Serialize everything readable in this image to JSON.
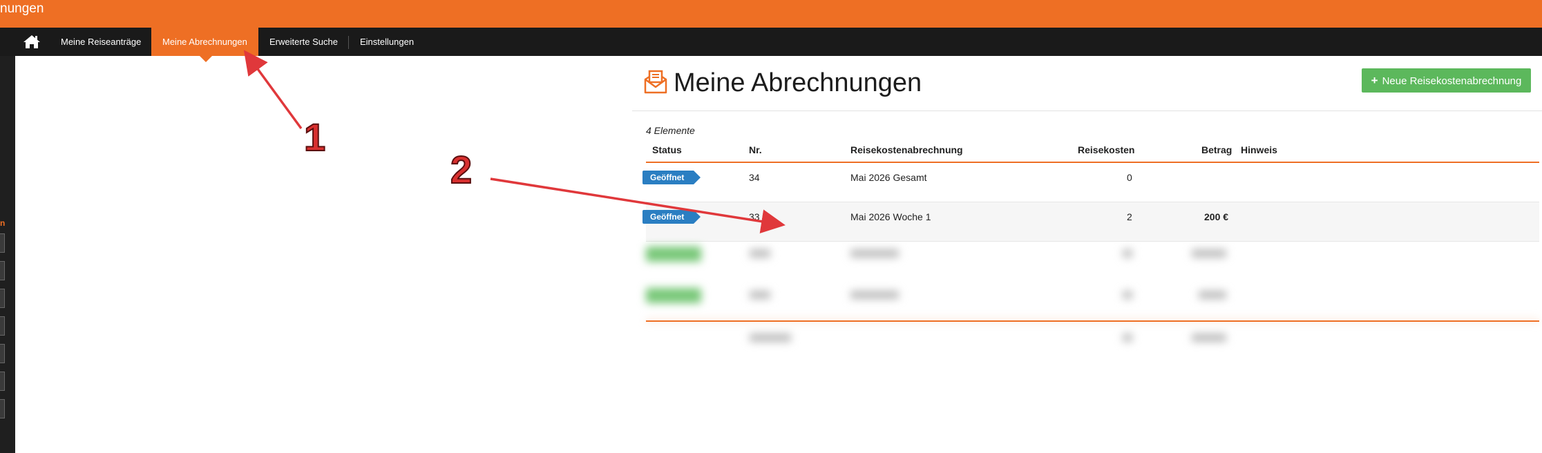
{
  "app": {
    "title": "nungen"
  },
  "nav": {
    "home_icon": "home-icon",
    "items": [
      {
        "label": "Meine Reiseanträge",
        "active": false
      },
      {
        "label": "Meine Abrechnungen",
        "active": true
      },
      {
        "label": "Erweiterte Suche",
        "active": false
      },
      {
        "label": "Einstellungen",
        "active": false
      }
    ]
  },
  "sidebar": {
    "partial_label": "n"
  },
  "page": {
    "title": "Meine Abrechnungen",
    "icon": "envelope-document-icon",
    "new_button_label": "Neue Reisekostenabrechnung",
    "new_button_icon": "plus-icon"
  },
  "table": {
    "count_label": "4 Elemente",
    "columns": [
      "Status",
      "Nr.",
      "Reisekostenabrechnung",
      "Reisekosten",
      "Betrag",
      "Hinweis"
    ],
    "rows": [
      {
        "status": "Geöffnet",
        "nr": "34",
        "name": "Mai 2026 Gesamt",
        "reisekosten": "0",
        "betrag": "",
        "hinweis": ""
      },
      {
        "status": "Geöffnet",
        "nr": "33",
        "name": "Mai 2026 Woche 1",
        "reisekosten": "2",
        "betrag": "200 €",
        "hinweis": ""
      }
    ]
  },
  "annotations": [
    {
      "label": "1"
    },
    {
      "label": "2"
    }
  ],
  "colors": {
    "accent": "#ee6f24",
    "navbar": "#1a1a1a",
    "badge": "#2a7ec2",
    "new_button": "#5cb85c",
    "annotation": "#e0383b"
  }
}
